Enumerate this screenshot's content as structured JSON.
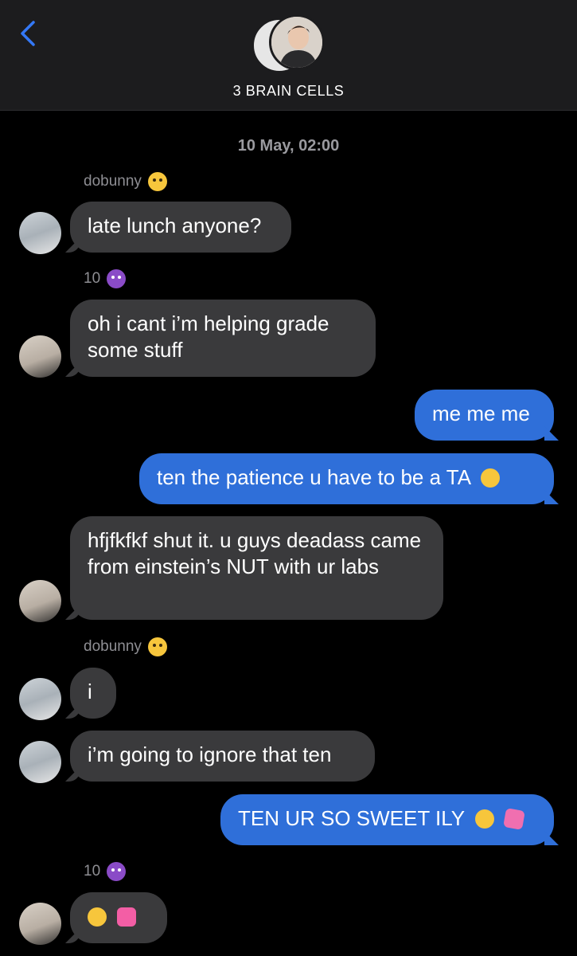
{
  "header": {
    "back_icon": "chevron-left-icon",
    "group_name": "3 BRAIN CELLS"
  },
  "timestamp": "10 May, 02:00",
  "senders": {
    "dobunny": "dobunny",
    "ten": "10"
  },
  "messages": [
    {
      "text": "late lunch anyone?"
    },
    {
      "text": "oh i cant i’m helping grade some stuff"
    },
    {
      "text": "me me me"
    },
    {
      "text": "ten the patience u have to be a TA"
    },
    {
      "text": "hfjfkfkf shut it. u guys deadass came from einstein’s NUT with ur labs"
    },
    {
      "text": "i"
    },
    {
      "text": "i’m going to ignore that ten"
    },
    {
      "text": "TEN UR SO SWEET ILY"
    },
    {
      "text": ""
    }
  ],
  "colors": {
    "incoming": "#3a3a3c",
    "outgoing": "#2f6fd9",
    "header_bg": "#1c1c1e",
    "accent": "#3478f6"
  }
}
